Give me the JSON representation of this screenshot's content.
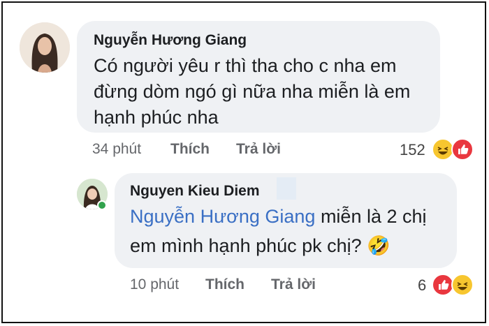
{
  "comments": [
    {
      "author": "Nguyễn Hương Giang",
      "lines": [
        "Có người yêu r thì tha cho c nha em",
        "đừng dòm ngó gì nữa nha miễn là em",
        "hạnh phúc nha"
      ],
      "time": "34 phút",
      "like_label": "Thích",
      "reply_label": "Trả lời",
      "reaction_count": "152",
      "reactions": [
        "haha-icon",
        "like-icon"
      ]
    },
    {
      "author": "Nguyen Kieu Diem",
      "mention": "Nguyễn Hương Giang",
      "line1_rest": " miễn là 2 chị",
      "line2": "em mình hạnh phúc pk chị? ",
      "emoji": "🤣",
      "time": "10 phút",
      "like_label": "Thích",
      "reply_label": "Trả lời",
      "reaction_count": "6",
      "reactions": [
        "like-icon",
        "haha-icon"
      ]
    }
  ]
}
